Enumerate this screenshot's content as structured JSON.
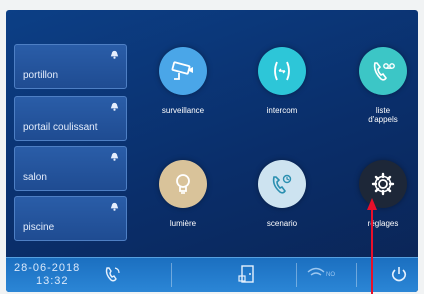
{
  "zones": [
    {
      "label": "portillon",
      "icon": "bell-icon"
    },
    {
      "label": "portail coulissant",
      "icon": "bell-icon"
    },
    {
      "label": "salon",
      "icon": "bell-icon"
    },
    {
      "label": "piscine",
      "icon": "bell-icon"
    }
  ],
  "apps": [
    {
      "label": "surveillance",
      "icon": "cctv-camera-icon",
      "color": "#4aa6e8"
    },
    {
      "label": "intercom",
      "icon": "intercom-phone-icon",
      "color": "#2dc6d8"
    },
    {
      "label": "liste\nd'appels",
      "icon": "voicemail-phone-icon",
      "color": "#3cc6c6"
    },
    {
      "label": "lumière",
      "icon": "light-bulb-icon",
      "color": "#d9c39a"
    },
    {
      "label": "scenario",
      "icon": "scenario-phone-icon",
      "color": "#cde3f0"
    },
    {
      "label": "réglages",
      "icon": "gear-icon",
      "color": "#1d2738"
    }
  ],
  "status_bar": {
    "date": "28-06-2018",
    "time": "13:32",
    "icons": [
      "call-icon",
      "door-unlock-icon",
      "wifi-icon",
      "power-icon"
    ],
    "wifi_text": "NO"
  },
  "annotation": {
    "arrow_color": "#e8102a"
  }
}
